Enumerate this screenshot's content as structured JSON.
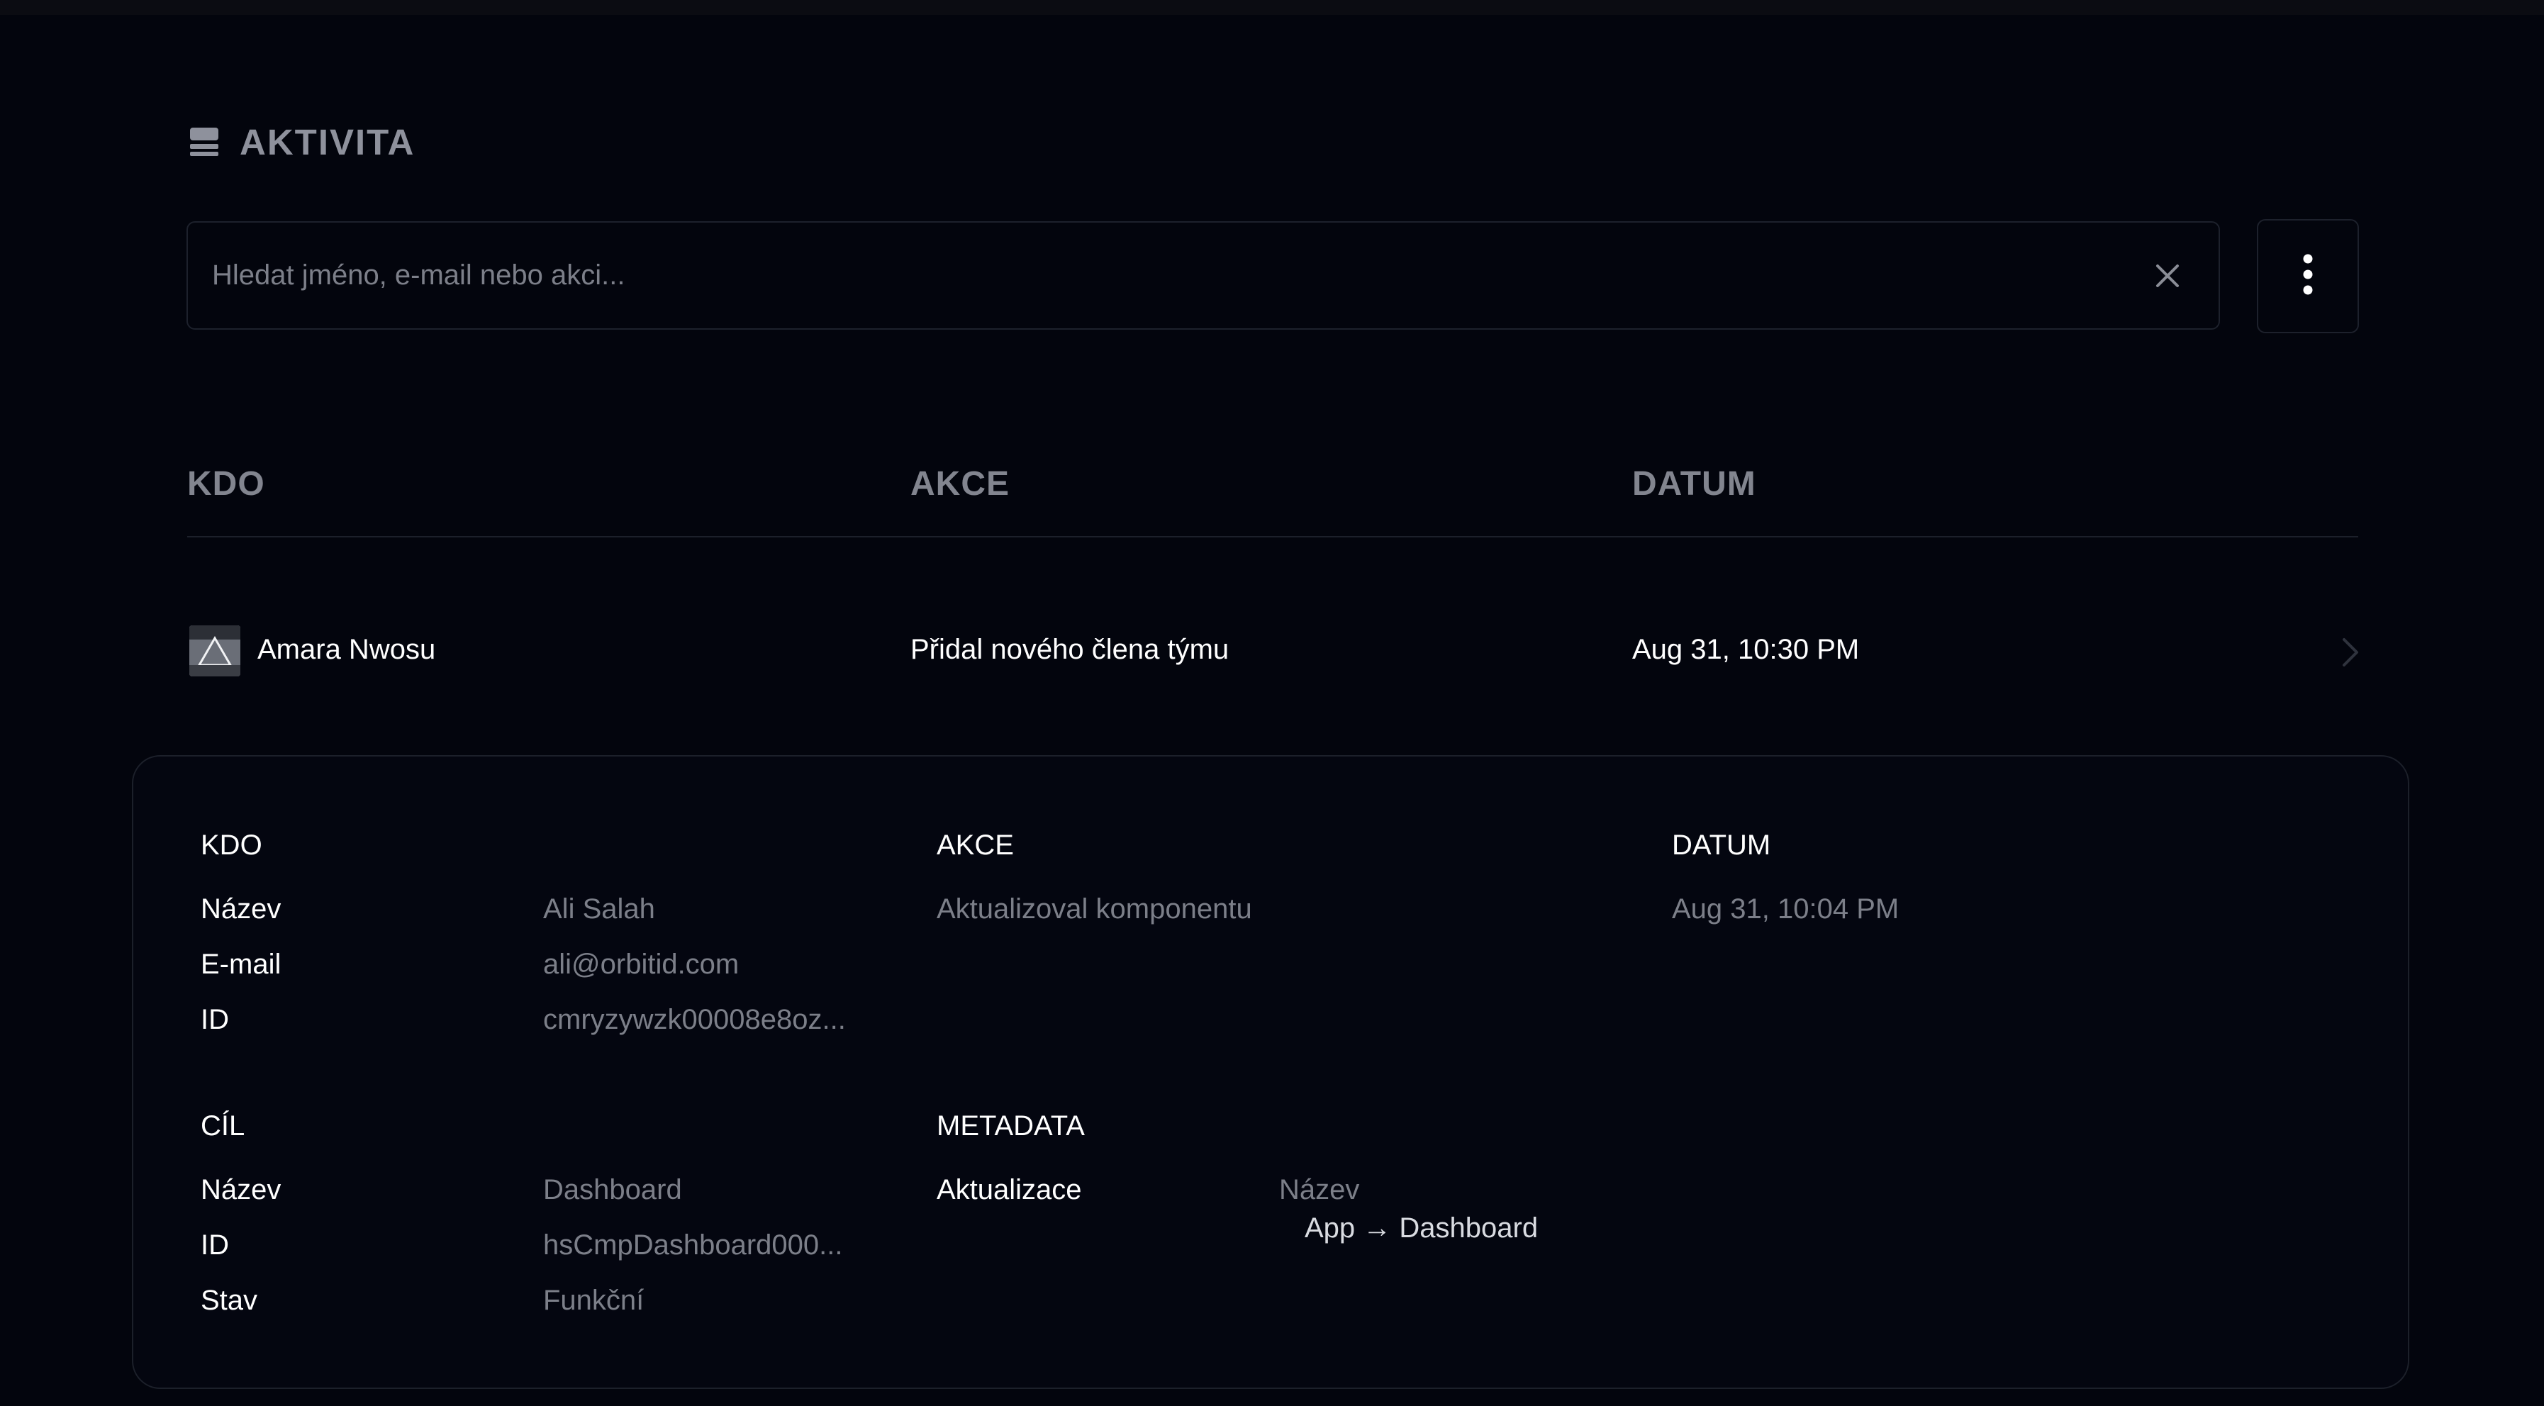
{
  "header": {
    "title": "AKTIVITA",
    "icon": "stack-icon"
  },
  "search": {
    "placeholder": "Hledat jméno, e-mail nebo akci...",
    "value": "",
    "clear_icon": "close-icon"
  },
  "more_menu": {
    "icon": "more-vertical-icon"
  },
  "table": {
    "columns": [
      "KDO",
      "AKCE",
      "DATUM"
    ],
    "rows": [
      {
        "name": "Amara Nwosu",
        "action": "Přidal nového člena týmu",
        "date": "Aug 31, 10:30 PM"
      }
    ]
  },
  "detail": {
    "who": {
      "title": "KDO",
      "name_label": "Název",
      "name_value": "Ali Salah",
      "email_label": "E-mail",
      "email_value": "ali@orbitid.com",
      "id_label": "ID",
      "id_value": "cmryzywzk00008e8oz..."
    },
    "action": {
      "title": "AKCE",
      "value": "Aktualizoval komponentu"
    },
    "date": {
      "title": "DATUM",
      "value": "Aug 31, 10:04 PM"
    },
    "target": {
      "title": "CÍL",
      "name_label": "Název",
      "name_value": "Dashboard",
      "id_label": "ID",
      "id_value": "hsCmpDashboard000...",
      "state_label": "Stav",
      "state_value": "Funkční"
    },
    "metadata": {
      "title": "METADATA",
      "update_label": "Aktualizace",
      "field_name": "Název",
      "change": "App → Dashboard"
    }
  },
  "colors": {
    "background": "#03050d",
    "border": "#1d212c",
    "muted_text": "#7c7f89",
    "header_text": "#8e919c"
  }
}
